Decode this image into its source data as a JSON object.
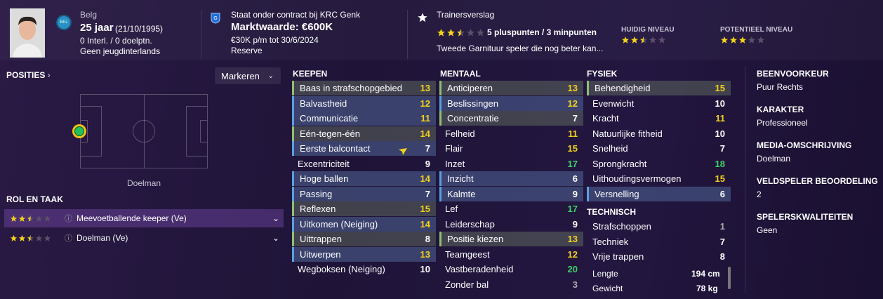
{
  "profile": {
    "nationality": "Belg",
    "flag_label": "BEL",
    "age": "25 jaar",
    "dob": "(21/10/1995)",
    "caps": "0 Interl. / 0 doelptn.",
    "youth": "Geen jeugdinterlands"
  },
  "contract": {
    "title": "Staat onder contract bij KRC Genk",
    "value": "Marktwaarde: €600K",
    "wage": "€30K p/m tot 30/6/2024",
    "squad": "Reserve"
  },
  "report": {
    "title": "Trainersverslag",
    "summary": "5 pluspunten / 3 minpunten",
    "text": "Tweede Garnituur speler die nog beter kan...",
    "current_label": "HUIDIG NIVEAU",
    "potential_label": "POTENTIEEL NIVEAU",
    "report_stars": 2.5,
    "current_stars": 2.5,
    "potential_stars": 3
  },
  "positions": {
    "title": "POSITIES",
    "mark_button": "Markeren",
    "position_name": "Doelman"
  },
  "roles": {
    "title": "ROL EN TAAK",
    "items": [
      {
        "label": "Meevoetballende keeper (Ve)",
        "stars": 2.5
      },
      {
        "label": "Doelman (Ve)",
        "stars": 2.5
      }
    ]
  },
  "keepen": {
    "title": "KEEPEN",
    "items": [
      {
        "n": "Baas in strafschopgebied",
        "v": "13"
      },
      {
        "n": "Balvastheid",
        "v": "12"
      },
      {
        "n": "Communicatie",
        "v": "11"
      },
      {
        "n": "Eén-tegen-één",
        "v": "14"
      },
      {
        "n": "Eerste balcontact",
        "v": "7"
      },
      {
        "n": "Excentriciteit",
        "v": "9"
      },
      {
        "n": "Hoge ballen",
        "v": "14"
      },
      {
        "n": "Passing",
        "v": "7"
      },
      {
        "n": "Reflexen",
        "v": "15"
      },
      {
        "n": "Uitkomen (Neiging)",
        "v": "14"
      },
      {
        "n": "Uittrappen",
        "v": "8"
      },
      {
        "n": "Uitwerpen",
        "v": "13"
      },
      {
        "n": "Wegboksen (Neiging)",
        "v": "10"
      }
    ]
  },
  "mentaal": {
    "title": "MENTAAL",
    "items": [
      {
        "n": "Anticiperen",
        "v": "13"
      },
      {
        "n": "Beslissingen",
        "v": "12"
      },
      {
        "n": "Concentratie",
        "v": "7"
      },
      {
        "n": "Felheid",
        "v": "11"
      },
      {
        "n": "Flair",
        "v": "15"
      },
      {
        "n": "Inzet",
        "v": "17"
      },
      {
        "n": "Inzicht",
        "v": "6"
      },
      {
        "n": "Kalmte",
        "v": "9"
      },
      {
        "n": "Lef",
        "v": "17"
      },
      {
        "n": "Leiderschap",
        "v": "9"
      },
      {
        "n": "Positie kiezen",
        "v": "13"
      },
      {
        "n": "Teamgeest",
        "v": "12"
      },
      {
        "n": "Vastberadenheid",
        "v": "20"
      },
      {
        "n": "Zonder bal",
        "v": "3"
      }
    ]
  },
  "fysiek": {
    "title": "FYSIEK",
    "items": [
      {
        "n": "Behendigheid",
        "v": "15"
      },
      {
        "n": "Evenwicht",
        "v": "10"
      },
      {
        "n": "Kracht",
        "v": "11"
      },
      {
        "n": "Natuurlijke fitheid",
        "v": "10"
      },
      {
        "n": "Snelheid",
        "v": "7"
      },
      {
        "n": "Sprongkracht",
        "v": "18"
      },
      {
        "n": "Uithoudingsvermogen",
        "v": "15"
      },
      {
        "n": "Versnelling",
        "v": "6"
      }
    ]
  },
  "technisch": {
    "title": "TECHNISCH",
    "items": [
      {
        "n": "Strafschoppen",
        "v": "1"
      },
      {
        "n": "Techniek",
        "v": "7"
      },
      {
        "n": "Vrije trappen",
        "v": "8"
      }
    ]
  },
  "physical": {
    "height_label": "Lengte",
    "height": "194 cm",
    "weight_label": "Gewicht",
    "weight": "78 kg"
  },
  "side": {
    "foot_label": "BEENVOORKEUR",
    "foot": "Puur Rechts",
    "char_label": "KARAKTER",
    "char": "Professioneel",
    "media_label": "MEDIA-OMSCHRIJVING",
    "media": "Doelman",
    "rating_label": "VELDSPELER BEOORDELING",
    "rating": "2",
    "qual_label": "SPELERSKWALITEITEN",
    "qual": "Geen"
  },
  "colors": {
    "yellow": "#f2d21b",
    "green": "#3ed36a",
    "accent": "#5aa0e0"
  }
}
